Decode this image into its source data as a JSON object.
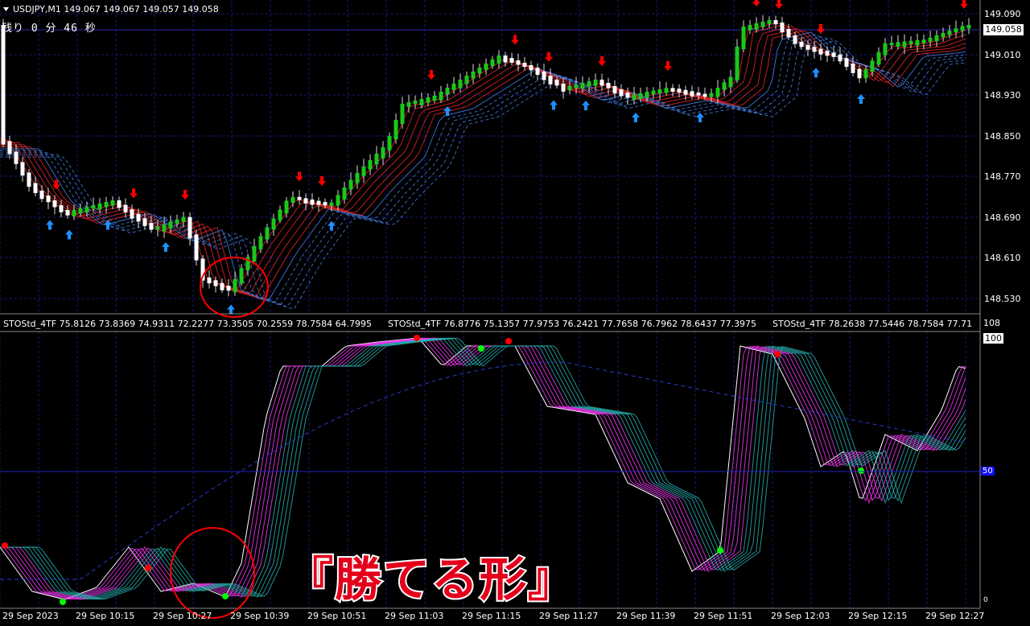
{
  "header": {
    "symbol_line": "USDJPY,M1  149.067 149.067 149.057 149.058",
    "timer_text": "残り 0 分 46 秒"
  },
  "price_axis": {
    "labels": [
      "149.090",
      "149.010",
      "148.930",
      "148.850",
      "148.770",
      "148.690",
      "148.610",
      "148.530"
    ],
    "current_price": "149.058"
  },
  "indicator": {
    "labels": [
      "STOStd_4TF 75.8126 73.8369 74.9311 72.2277 73.3505 70.2559 78.7584 64.7995",
      "STOStd_4TF 76.8776 75.1357 77.9753 76.2421 77.7658 76.7962 78.6437 77.3975",
      "STOStd_4TF 78.2638 77.5446 78.7584 77.71"
    ],
    "axis_top": "108",
    "level_100": "100",
    "level_50": "50",
    "axis_bottom": "0"
  },
  "time_axis": {
    "labels": [
      "29 Sep 2023",
      "29 Sep 10:15",
      "29 Sep 10:27",
      "29 Sep 10:39",
      "29 Sep 10:51",
      "29 Sep 11:03",
      "29 Sep 11:15",
      "29 Sep 11:27",
      "29 Sep 11:39",
      "29 Sep 11:51",
      "29 Sep 12:03",
      "29 Sep 12:15",
      "29 Sep 12:27"
    ]
  },
  "overlay": {
    "caption": "『勝てる形』"
  },
  "colors": {
    "background": "#000000",
    "grid": "#1a1a7a",
    "bull_candle": "#19c819",
    "bear_candle": "#ffffff",
    "ribbon_red": "#ff2a2a",
    "ribbon_blue": "#4a8cff",
    "arrow_up": "#1e90ff",
    "arrow_down": "#ff0000",
    "stoch_fast": "#ffffff",
    "stoch_magenta": "#ff3cff",
    "stoch_teal": "#2ab4b4",
    "signal_dot_green": "#00ff00",
    "signal_dot_red": "#ff0000",
    "highlight_circle": "#ff0000"
  }
}
